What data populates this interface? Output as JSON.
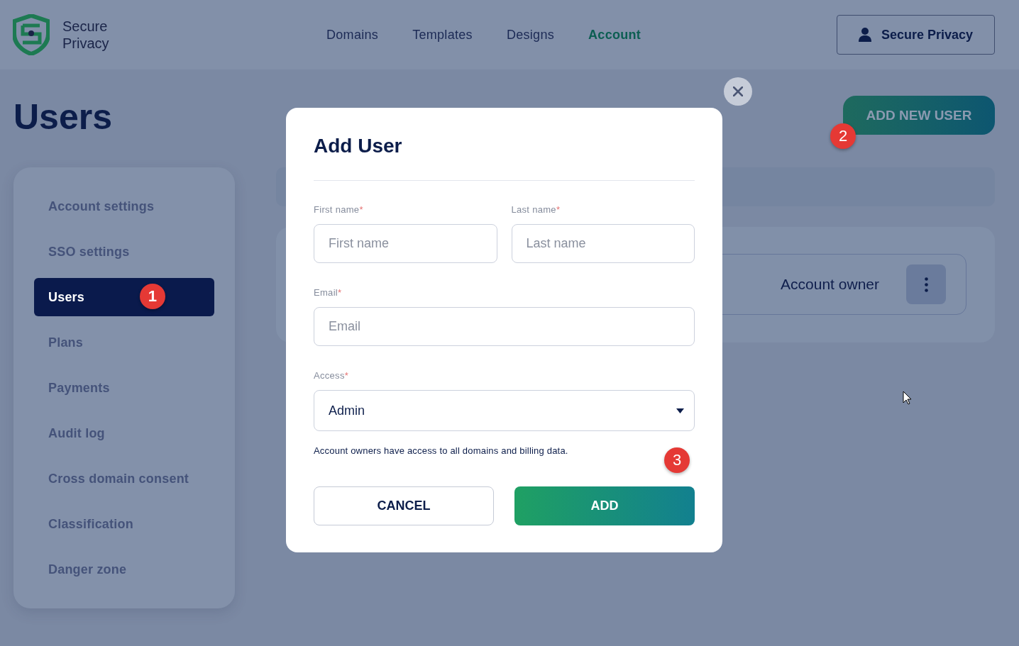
{
  "header": {
    "logo_lines": [
      "Secure",
      "Privacy"
    ],
    "nav": [
      {
        "label": "Domains",
        "selected": false
      },
      {
        "label": "Templates",
        "selected": false
      },
      {
        "label": "Designs",
        "selected": false
      },
      {
        "label": "Account",
        "selected": true
      }
    ],
    "account_button": "Secure Privacy"
  },
  "page_title": "Users",
  "sidebar": {
    "items": [
      {
        "label": "Account settings",
        "selected": false
      },
      {
        "label": "SSO settings",
        "selected": false
      },
      {
        "label": "Users",
        "selected": true,
        "badge": "1"
      },
      {
        "label": "Plans",
        "selected": false
      },
      {
        "label": "Payments",
        "selected": false
      },
      {
        "label": "Audit log",
        "selected": false
      },
      {
        "label": "Cross domain consent",
        "selected": false
      },
      {
        "label": "Classification",
        "selected": false
      },
      {
        "label": "Danger zone",
        "selected": false
      }
    ]
  },
  "add_new_user_button": {
    "label": "ADD NEW USER",
    "badge": "2"
  },
  "user_row": {
    "role": "Account owner"
  },
  "modal": {
    "title": "Add User",
    "fields": [
      {
        "label": "First name",
        "mark": "*",
        "placeholder": "First name",
        "kind": "input"
      },
      {
        "label": "Last name",
        "mark": "*",
        "placeholder": "Last name",
        "kind": "input"
      },
      {
        "label": "Email",
        "mark": "*",
        "placeholder": "Email",
        "kind": "input"
      },
      {
        "label": "Access",
        "mark": "*",
        "value": "Admin",
        "kind": "select"
      }
    ],
    "help_text": "Account owners have access to all domains and billing data.",
    "badge": "3",
    "buttons": [
      {
        "label": "CANCEL",
        "kind": "secondary"
      },
      {
        "label": "ADD",
        "kind": "primary"
      }
    ]
  }
}
